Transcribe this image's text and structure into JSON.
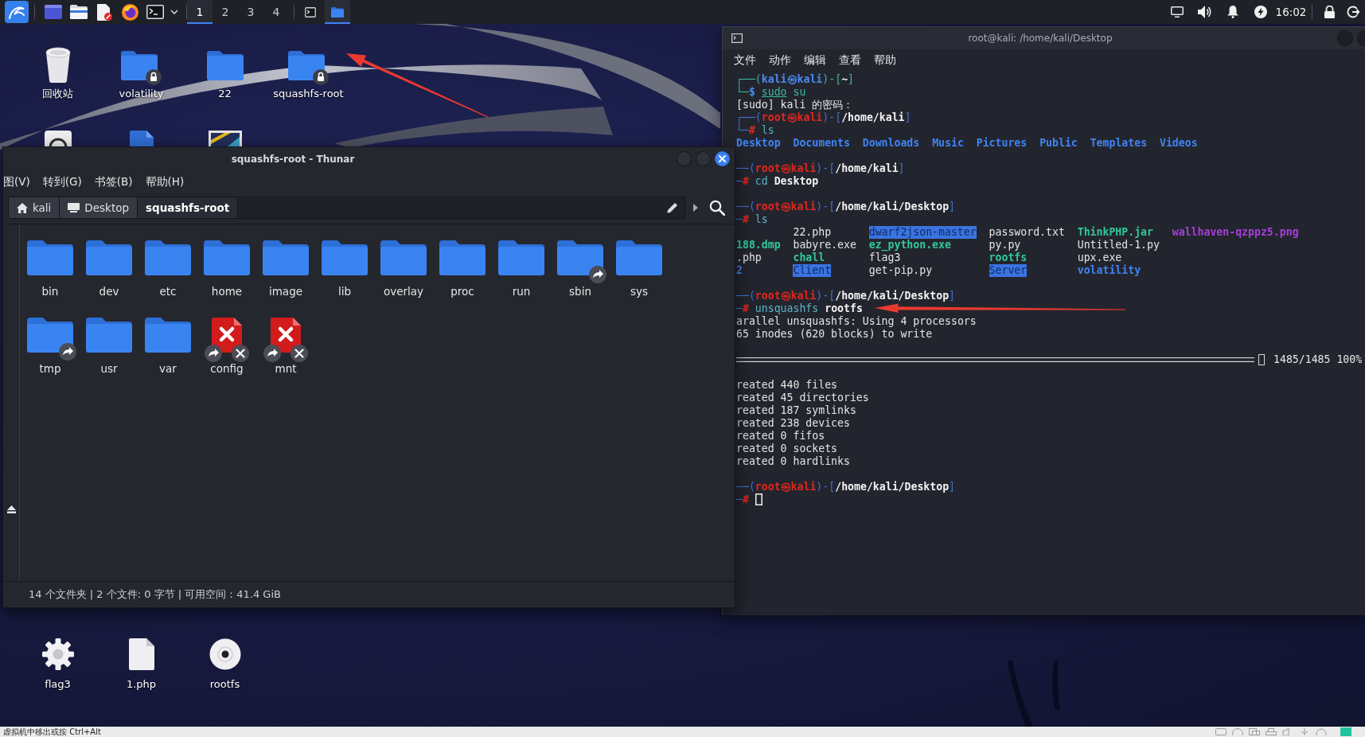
{
  "panel": {
    "workspaces": [
      {
        "label": "1",
        "selected": true
      },
      {
        "label": "2",
        "selected": false
      },
      {
        "label": "3",
        "selected": false
      },
      {
        "label": "4",
        "selected": false
      }
    ],
    "tasks": [
      {
        "kind": "terminal",
        "selected": false
      },
      {
        "kind": "folder",
        "selected": true
      }
    ],
    "clock": "16:02"
  },
  "desktop": {
    "icons": [
      {
        "label": "回收站",
        "kind": "trash",
        "locked": false
      },
      {
        "label": "volatility",
        "kind": "folder",
        "locked": true
      },
      {
        "label": "22",
        "kind": "folder",
        "locked": false
      },
      {
        "label": "squashfs-root",
        "kind": "folder",
        "locked": true
      }
    ],
    "covered_icons": [
      {
        "kind": "tile"
      },
      {
        "kind": "document"
      },
      {
        "kind": "picture"
      }
    ],
    "bottom_icons": [
      {
        "label": "flag3",
        "kind": "gear"
      },
      {
        "label": "1.php",
        "kind": "file"
      },
      {
        "label": "rootfs",
        "kind": "disc"
      }
    ]
  },
  "thunar": {
    "title": "squashfs-root - Thunar",
    "menu": [
      "图(V)",
      "转到(G)",
      "书签(B)",
      "帮助(H)"
    ],
    "path": [
      {
        "label": "kali",
        "kind": "home",
        "selected": false
      },
      {
        "label": "Desktop",
        "kind": "desktop",
        "selected": false
      },
      {
        "label": "squashfs-root",
        "selected": true
      }
    ],
    "items": [
      {
        "name": "bin",
        "kind": "folder"
      },
      {
        "name": "dev",
        "kind": "folder"
      },
      {
        "name": "etc",
        "kind": "folder"
      },
      {
        "name": "home",
        "kind": "folder"
      },
      {
        "name": "image",
        "kind": "folder"
      },
      {
        "name": "lib",
        "kind": "folder"
      },
      {
        "name": "overlay",
        "kind": "folder"
      },
      {
        "name": "proc",
        "kind": "folder"
      },
      {
        "name": "run",
        "kind": "folder"
      },
      {
        "name": "sbin",
        "kind": "folder-link"
      },
      {
        "name": "sys",
        "kind": "folder"
      },
      {
        "name": "tmp",
        "kind": "folder-link"
      },
      {
        "name": "usr",
        "kind": "folder"
      },
      {
        "name": "var",
        "kind": "folder"
      },
      {
        "name": "config",
        "kind": "broken-link"
      },
      {
        "name": "mnt",
        "kind": "broken-link"
      }
    ],
    "status": "14 个文件夹 | 2 个文件: 0 字节 | 可用空间：41.4 GiB"
  },
  "terminal": {
    "title": "root@kali: /home/kali/Desktop",
    "menu": [
      "文件",
      "动作",
      "编辑",
      "查看",
      "帮助"
    ],
    "lines": [
      {
        "kind": "text",
        "segments": [
          {
            "text": "┌──(",
            "kind": "frame-user"
          },
          {
            "text": "kali㉿kali",
            "kind": "user"
          },
          {
            "text": ")-[",
            "kind": "frame-user"
          },
          {
            "text": "~",
            "kind": "path"
          },
          {
            "text": "]",
            "kind": "frame-user"
          }
        ]
      },
      {
        "kind": "text",
        "segments": [
          {
            "text": "└─",
            "kind": "frame-user"
          },
          {
            "text": "$",
            "kind": "sigil-user"
          },
          {
            "text": "sudo",
            "kind": "precmd"
          },
          {
            "text": "su",
            "kind": "cmd-user"
          }
        ]
      },
      {
        "kind": "text",
        "segments": [
          {
            "text": "[sudo] kali 的密码：",
            "kind": "out"
          }
        ]
      },
      {
        "kind": "text",
        "segments": [
          {
            "text": "┌──(",
            "kind": "frame-root"
          },
          {
            "text": "root㉿kali",
            "kind": "root"
          },
          {
            "text": ")-[",
            "kind": "frame-root"
          },
          {
            "text": "/home/kali",
            "kind": "path"
          },
          {
            "text": "]",
            "kind": "frame-root"
          }
        ]
      },
      {
        "kind": "text",
        "segments": [
          {
            "text": "└─",
            "kind": "frame-root"
          },
          {
            "text": "#",
            "kind": "sigil-root"
          },
          {
            "text": "ls",
            "kind": "cmd"
          }
        ]
      },
      {
        "kind": "list",
        "segments": [
          {
            "text": "Desktop",
            "kind": "dir"
          },
          {
            "text": "Documents",
            "kind": "dir"
          },
          {
            "text": "Downloads",
            "kind": "dir"
          },
          {
            "text": "Music",
            "kind": "dir"
          },
          {
            "text": "Pictures",
            "kind": "dir"
          },
          {
            "text": "Public",
            "kind": "dir"
          },
          {
            "text": "Templates",
            "kind": "dir"
          },
          {
            "text": "Videos",
            "kind": "dir"
          }
        ]
      },
      {
        "kind": "blank"
      },
      {
        "kind": "text",
        "segments": [
          {
            "text": "──(",
            "kind": "frame-root"
          },
          {
            "text": "root㉿kali",
            "kind": "root"
          },
          {
            "text": ")-[",
            "kind": "frame-root"
          },
          {
            "text": "/home/kali",
            "kind": "path"
          },
          {
            "text": "]",
            "kind": "frame-root"
          }
        ]
      },
      {
        "kind": "text",
        "segments": [
          {
            "text": "─",
            "kind": "frame-root"
          },
          {
            "text": "#",
            "kind": "sigil-root"
          },
          {
            "text": "cd",
            "kind": "cmd"
          },
          {
            "text": "Desktop",
            "kind": "arg"
          }
        ]
      },
      {
        "kind": "blank"
      },
      {
        "kind": "text",
        "segments": [
          {
            "text": "──(",
            "kind": "frame-root"
          },
          {
            "text": "root㉿kali",
            "kind": "root"
          },
          {
            "text": ")-[",
            "kind": "frame-root"
          },
          {
            "text": "/home/kali/Desktop",
            "kind": "path"
          },
          {
            "text": "]",
            "kind": "frame-root"
          }
        ]
      },
      {
        "kind": "text",
        "segments": [
          {
            "text": "─",
            "kind": "frame-root"
          },
          {
            "text": "#",
            "kind": "sigil-root"
          },
          {
            "text": "ls",
            "kind": "cmd"
          }
        ]
      },
      {
        "kind": "columns",
        "cells": [
          null,
          {
            "text": "22.php",
            "kind": "out"
          },
          {
            "text": "dwarf2json-master",
            "kind": "dir-sticky"
          },
          {
            "text": "password.txt",
            "kind": "out"
          },
          {
            "text": "ThinkPHP.jar",
            "kind": "exec"
          },
          {
            "text": "wallhaven-qzppz5.png",
            "kind": "image"
          }
        ]
      },
      {
        "kind": "columns",
        "cells": [
          {
            "text": "188.dmp",
            "kind": "exec"
          },
          {
            "text": "babyre.exe",
            "kind": "out"
          },
          {
            "text": "ez_python.exe",
            "kind": "exec"
          },
          {
            "text": "py.py",
            "kind": "out"
          },
          {
            "text": "Untitled-1.py",
            "kind": "out"
          }
        ]
      },
      {
        "kind": "columns",
        "cells": [
          {
            "text": ".php",
            "kind": "out"
          },
          {
            "text": "chall",
            "kind": "exec"
          },
          {
            "text": "flag3",
            "kind": "out"
          },
          {
            "text": "rootfs",
            "kind": "exec"
          },
          {
            "text": "upx.exe",
            "kind": "out"
          }
        ]
      },
      {
        "kind": "columns",
        "cells": [
          {
            "text": "2",
            "kind": "dir"
          },
          {
            "text": "Client",
            "kind": "dir-sticky"
          },
          {
            "text": "get-pip.py",
            "kind": "out"
          },
          {
            "text": "Server",
            "kind": "dir-sticky"
          },
          {
            "text": "volatility",
            "kind": "dir"
          }
        ]
      },
      {
        "kind": "blank"
      },
      {
        "kind": "text",
        "segments": [
          {
            "text": "──(",
            "kind": "frame-root"
          },
          {
            "text": "root㉿kali",
            "kind": "root"
          },
          {
            "text": ")-[",
            "kind": "frame-root"
          },
          {
            "text": "/home/kali/Desktop",
            "kind": "path"
          },
          {
            "text": "]",
            "kind": "frame-root"
          }
        ]
      },
      {
        "kind": "text",
        "segments": [
          {
            "text": "─",
            "kind": "frame-root"
          },
          {
            "text": "#",
            "kind": "sigil-root"
          },
          {
            "text": "unsquashfs",
            "kind": "cmd"
          },
          {
            "text": "rootfs",
            "kind": "arg"
          }
        ]
      },
      {
        "kind": "text",
        "segments": [
          {
            "text": "arallel unsquashfs: Using 4 processors",
            "kind": "out"
          }
        ]
      },
      {
        "kind": "text",
        "segments": [
          {
            "text": "65 inodes (620 blocks) to write",
            "kind": "out"
          }
        ]
      },
      {
        "kind": "blank"
      },
      {
        "kind": "progress",
        "level": 1,
        "reading": "1485/1485 100%"
      },
      {
        "kind": "blank"
      },
      {
        "kind": "text",
        "segments": [
          {
            "text": "reated 440 files",
            "kind": "out"
          }
        ]
      },
      {
        "kind": "text",
        "segments": [
          {
            "text": "reated 45 directories",
            "kind": "out"
          }
        ]
      },
      {
        "kind": "text",
        "segments": [
          {
            "text": "reated 187 symlinks",
            "kind": "out"
          }
        ]
      },
      {
        "kind": "text",
        "segments": [
          {
            "text": "reated 238 devices",
            "kind": "out"
          }
        ]
      },
      {
        "kind": "text",
        "segments": [
          {
            "text": "reated 0 fifos",
            "kind": "out"
          }
        ]
      },
      {
        "kind": "text",
        "segments": [
          {
            "text": "reated 0 sockets",
            "kind": "out"
          }
        ]
      },
      {
        "kind": "text",
        "segments": [
          {
            "text": "reated 0 hardlinks",
            "kind": "out"
          }
        ]
      },
      {
        "kind": "blank"
      },
      {
        "kind": "text",
        "segments": [
          {
            "text": "──(",
            "kind": "frame-root"
          },
          {
            "text": "root㉿kali",
            "kind": "root"
          },
          {
            "text": ")-[",
            "kind": "frame-root"
          },
          {
            "text": "/home/kali/Desktop",
            "kind": "path"
          },
          {
            "text": "]",
            "kind": "frame-root"
          }
        ]
      },
      {
        "kind": "input",
        "segments": [
          {
            "text": "─",
            "kind": "frame-root"
          },
          {
            "text": "#",
            "kind": "sigil-root"
          }
        ]
      }
    ]
  },
  "vm_bar": {
    "hint": "虚拟机中移出或按 Ctrl+Alt"
  }
}
